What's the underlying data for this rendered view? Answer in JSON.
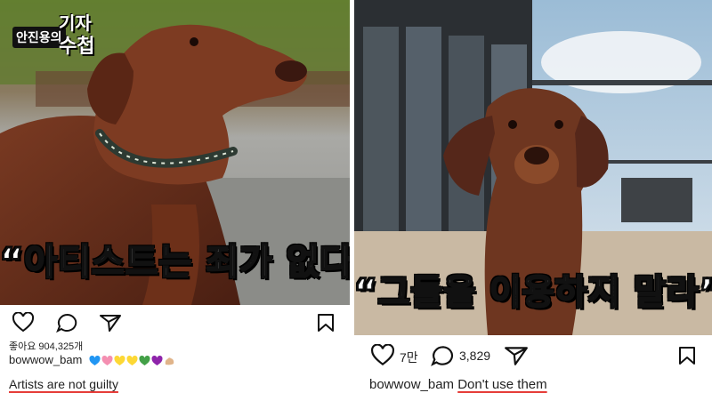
{
  "badge": {
    "name": "안진용의",
    "title1": "기자",
    "title2": "수첩"
  },
  "left_post": {
    "caption_overlay": "“아티스트는 죄가 없다”",
    "likes_text": "좋아요 904,325개",
    "username": "bowwow_bam",
    "caption": "Artists are not guilty",
    "emoji_hearts": [
      "#2196f3",
      "#f48fb1",
      "#fdd835",
      "#fdd835",
      "#43a047",
      "#8e24aa"
    ],
    "icons": [
      "heart-icon",
      "comment-icon",
      "share-icon",
      "bookmark-icon"
    ]
  },
  "right_post": {
    "caption_overlay": "“그들을 이용하지 말라”",
    "like_count": "7만",
    "comment_count": "3,829",
    "username": "bowwow_bam",
    "caption": "Don't use them",
    "icons": [
      "heart-icon",
      "comment-icon",
      "share-icon",
      "bookmark-icon"
    ]
  },
  "colors": {
    "underline": "#e53935",
    "text": "#222222"
  }
}
